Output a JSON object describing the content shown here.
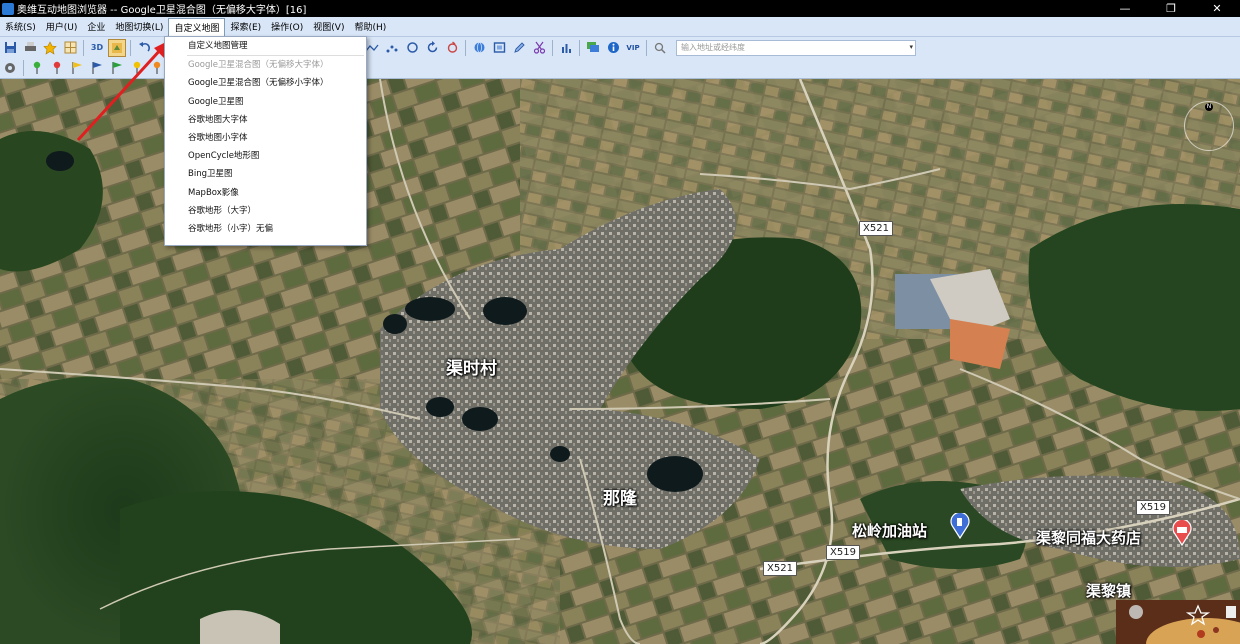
{
  "window": {
    "title": "奥维互动地图浏览器 -- Google卫星混合图（无偏移大字体）[16]",
    "controls": [
      "—",
      "❐",
      "✕"
    ]
  },
  "menu": [
    {
      "label": "系统(S)"
    },
    {
      "label": "用户(U)"
    },
    {
      "label": "企业"
    },
    {
      "label": "地图切换(L)"
    },
    {
      "label": "自定义地图"
    },
    {
      "label": "探索(E)"
    },
    {
      "label": "操作(O)"
    },
    {
      "label": "视图(V)"
    },
    {
      "label": "帮助(H)"
    }
  ],
  "toolbar": {
    "btn_3d": "3D",
    "vip": "VIP",
    "search_placeholder": "输入地址或经纬度"
  },
  "dropdown": {
    "items": [
      {
        "label": "自定义地图管理",
        "disabled": false
      },
      {
        "label": "Google卫星混合图（无偏移大字体）",
        "disabled": true
      },
      {
        "label": "Google卫星混合图（无偏移小字体）",
        "disabled": false
      },
      {
        "label": "Google卫星图",
        "disabled": false
      },
      {
        "label": "谷歌地图大字体",
        "disabled": false
      },
      {
        "label": "谷歌地图小字体",
        "disabled": false
      },
      {
        "label": "OpenCycle地形图",
        "disabled": false
      },
      {
        "label": "Bing卫星图",
        "disabled": false
      },
      {
        "label": "MapBox影像",
        "disabled": false
      },
      {
        "label": "谷歌地形（大字）",
        "disabled": false
      },
      {
        "label": "谷歌地形（小字）无偏",
        "disabled": false
      }
    ]
  },
  "map": {
    "places": [
      "渠时村",
      "那隆",
      "松岭加油站",
      "渠黎同福大药店",
      "渠黎镇"
    ],
    "roads": [
      "X521",
      "X519",
      "X519",
      "X521"
    ],
    "compass_label": "N",
    "colors": {
      "accent_pin": "#e84c4c",
      "fuel_pin": "#3f6fd6"
    }
  }
}
